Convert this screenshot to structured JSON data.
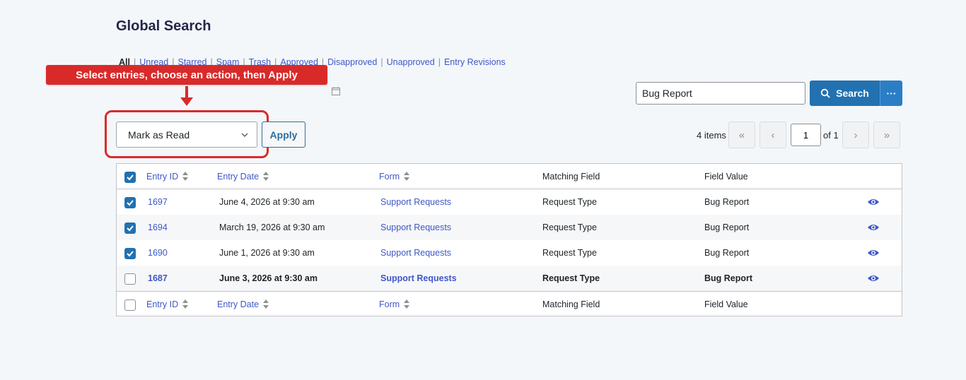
{
  "page": {
    "title": "Global Search"
  },
  "filters": [
    {
      "label": "All",
      "current": true
    },
    {
      "label": "Unread"
    },
    {
      "label": "Starred"
    },
    {
      "label": "Spam"
    },
    {
      "label": "Trash"
    },
    {
      "label": "Approved"
    },
    {
      "label": "Disapproved"
    },
    {
      "label": "Unapproved"
    },
    {
      "label": "Entry Revisions"
    }
  ],
  "callout": {
    "text": "Select entries, choose an action, then Apply"
  },
  "bulk_actions": {
    "selected": "Mark as Read",
    "apply_label": "Apply"
  },
  "search": {
    "value": "Bug Report",
    "button_label": "Search",
    "more_label": "···"
  },
  "pagination": {
    "count": "4 items",
    "first": "«",
    "prev": "‹",
    "current_page": "1",
    "of_label": "of 1",
    "next": "›",
    "last": "»"
  },
  "table": {
    "columns": {
      "entry_id": "Entry ID",
      "entry_date": "Entry Date",
      "form": "Form",
      "matching_field": "Matching Field",
      "field_value": "Field Value"
    },
    "rows": [
      {
        "id": "1697",
        "date": "June 4, 2026 at 9:30 am",
        "form": "Support Requests",
        "field": "Request Type",
        "value": "Bug Report",
        "checked": true,
        "unread": false
      },
      {
        "id": "1694",
        "date": "March 19, 2026 at 9:30 am",
        "form": "Support Requests",
        "field": "Request Type",
        "value": "Bug Report",
        "checked": true,
        "unread": false
      },
      {
        "id": "1690",
        "date": "June 1, 2026 at 9:30 am",
        "form": "Support Requests",
        "field": "Request Type",
        "value": "Bug Report",
        "checked": true,
        "unread": false
      },
      {
        "id": "1687",
        "date": "June 3, 2026 at 9:30 am",
        "form": "Support Requests",
        "field": "Request Type",
        "value": "Bug Report",
        "checked": false,
        "unread": true
      }
    ]
  },
  "colors": {
    "accent": "#2271b1",
    "link": "#3e58c7",
    "callout": "#d92a2a"
  }
}
